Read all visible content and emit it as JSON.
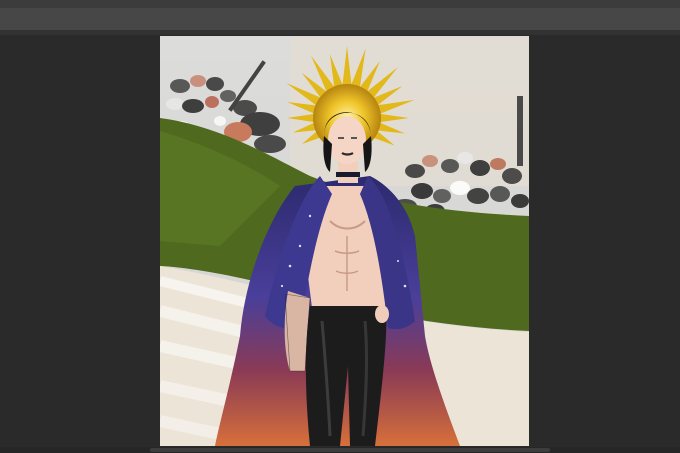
{
  "window": {
    "title": ""
  },
  "canvas": {
    "artwork": "illustration-of-figure-with-golden-halo",
    "background_color": "#d8d8d6"
  },
  "colors": {
    "workspace": "#2a2a2a",
    "toolbar": "#474747",
    "halo_gold": "#e2b81a",
    "cape_blue": "#3f3a8e",
    "grass_green": "#4f6a1e"
  }
}
